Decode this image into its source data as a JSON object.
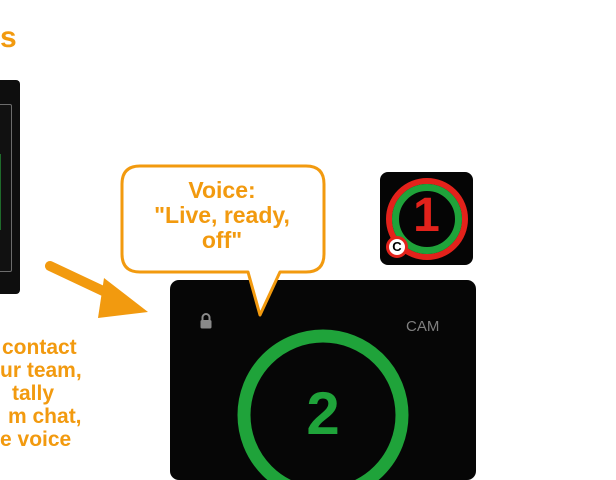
{
  "heading": {
    "fragment": "s"
  },
  "body_text": {
    "lines": [
      "contact",
      "ur team,",
      "tally",
      "m chat,",
      "e voice"
    ]
  },
  "speech_bubble": {
    "lines": [
      "Voice:",
      "\"Live, ready,",
      "off\""
    ]
  },
  "tile_small": {
    "number": "1",
    "badge": "C",
    "ring_outer_color": "#e3221b",
    "ring_inner_color": "#1fa33a"
  },
  "tile_main": {
    "number": "2",
    "source_label": "CAM",
    "ring_color": "#1fa33a",
    "icon": "lock-icon"
  },
  "colors": {
    "accent_orange": "#f29a0f",
    "tally_red": "#e3221b",
    "tally_green": "#1fa33a",
    "tile_bg": "#060606"
  }
}
